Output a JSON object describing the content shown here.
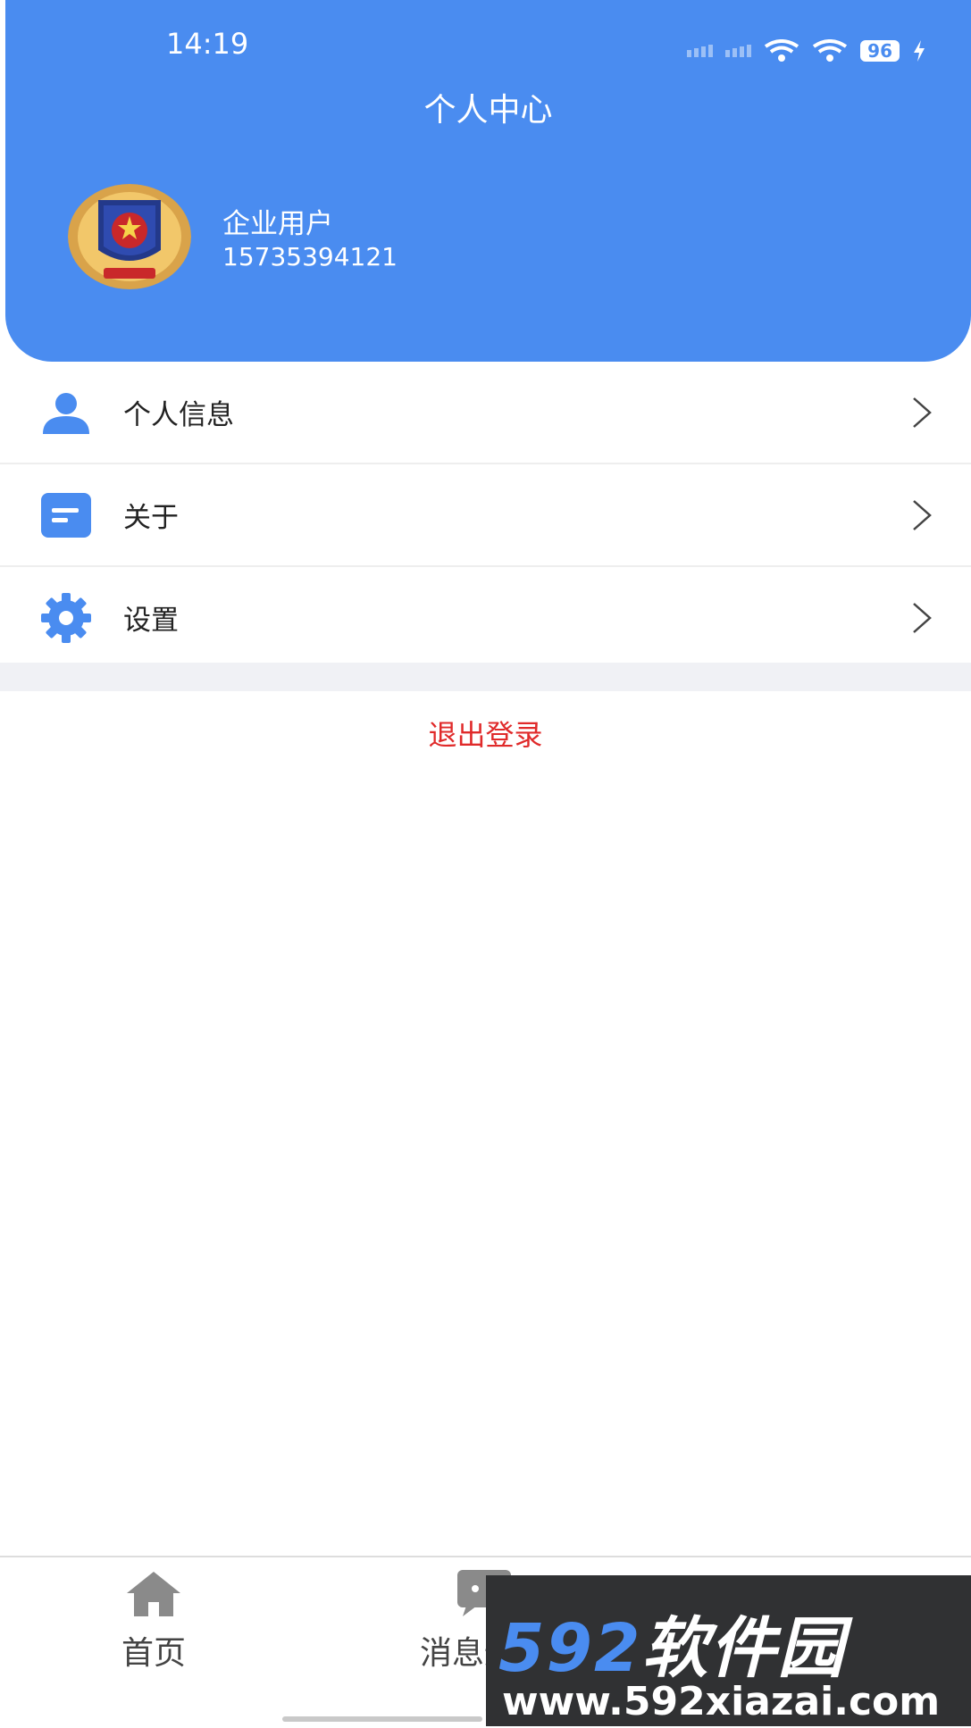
{
  "status_bar": {
    "time": "14:19",
    "battery": "96"
  },
  "header": {
    "title": "个人中心"
  },
  "user": {
    "name": "企业用户",
    "phone": "15735394121"
  },
  "menu": [
    {
      "label": "个人信息",
      "icon": "user-icon"
    },
    {
      "label": "关于",
      "icon": "document-icon"
    },
    {
      "label": "设置",
      "icon": "gear-icon"
    }
  ],
  "logout_label": "退出登录",
  "tabs": [
    {
      "label": "首页",
      "icon": "home-icon"
    },
    {
      "label": "消息通知",
      "icon": "message-icon"
    }
  ],
  "watermark": {
    "brand_num": "592",
    "brand_text": "软件园",
    "url": "www.592xiazai.com"
  },
  "colors": {
    "primary": "#4a8cf0",
    "danger": "#e02a2a",
    "divider": "#eeeeee"
  }
}
